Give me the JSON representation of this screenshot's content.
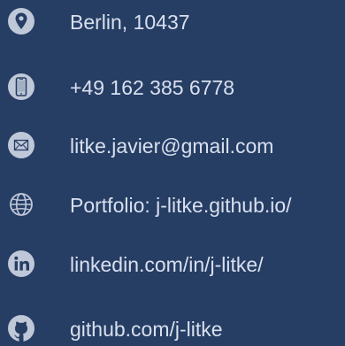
{
  "contacts": {
    "address": {
      "text": "Berlin, 10437",
      "icon": "location-pin-icon"
    },
    "phone": {
      "text": "+49 162 385 6778",
      "icon": "smartphone-icon"
    },
    "email": {
      "text": "litke.javier@gmail.com",
      "icon": "envelope-icon"
    },
    "portfolio": {
      "text": "Portfolio: j-litke.github.io/",
      "icon": "globe-icon"
    },
    "linkedin": {
      "text": "linkedin.com/in/j-litke/",
      "icon": "linkedin-icon"
    },
    "github": {
      "text": "github.com/j-litke",
      "icon": "github-icon"
    }
  },
  "colors": {
    "background": "#263d64",
    "text": "#d8e0ee",
    "icon": "#bfc8d8"
  }
}
